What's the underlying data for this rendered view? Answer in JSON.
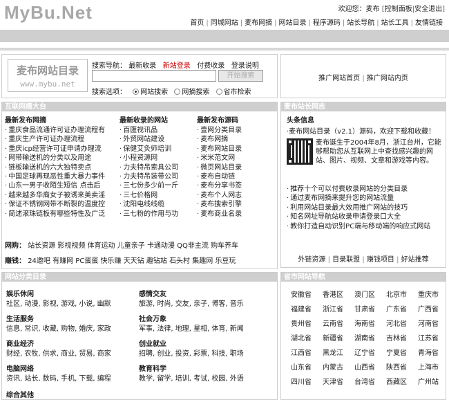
{
  "logo": "MyBu.Net",
  "welcome": {
    "prefix": "欢迎您：",
    "user": "麦布",
    "panel": "控制面板",
    "logout": "安全退出"
  },
  "topnav": [
    "首页",
    "同城网站",
    "麦布网摘",
    "网站目录",
    "程序源码",
    "站长导航",
    "站长工具",
    "友情链接"
  ],
  "search": {
    "site_logo_title": "麦布网站目录",
    "site_logo_url": "www.mybu.net",
    "nav_label": "搜索导航：",
    "nav_links": [
      "最新收录",
      "新站登录",
      "付费收录",
      "登录说明"
    ],
    "button": "开始搜索",
    "options_label": "搜索选项：",
    "options": [
      "网站搜索",
      "网摘搜索",
      "省市检索"
    ]
  },
  "promo": {
    "links": [
      "推广网站首页",
      "推广网站内页"
    ]
  },
  "left": {
    "header": "互联网摘大台",
    "col_heads": [
      "最新发布网摘",
      "最新收录的网站",
      "最新发布源码"
    ],
    "col1": [
      "重庆食品流通许可证办理流程有",
      "重庆生产许可证办理流程",
      "重庆icp经营许可证申请办理流",
      "网带输送机的分类以及用途",
      "链板输送机的六大独特卖点",
      "中国足球再现恶性重大暴力事件",
      "山东一男子收陌生短信 点击后",
      "越来越多华裔女子被诱来美卖淫",
      "保证不锈钢网带不断裂的温度控",
      "简述滚珠链板有哪些特性及广泛"
    ],
    "col2": [
      "百匯视讯品",
      "外贸网站建设",
      "保健艾灸师培训",
      "小程资源网",
      "力夫特吊索具公司",
      "力夫特吊装带公司",
      "三七份多少前一斤",
      "三七价格网",
      "沈阳电线线缆",
      "三七粉的作用与功"
    ],
    "col3": [
      "壹网分类目录",
      "麦布网摘",
      "麦布网站目录",
      "米米范文网",
      "微页网站目录",
      "麦布自动链",
      "麦布分享书签",
      "麦布个人网志",
      "麦布搜索引擎",
      "麦布商业名录"
    ],
    "row_wangou_label": "网购：",
    "row_wangou": [
      "站长资源",
      "影视视频",
      "体育运动",
      "儿童亲子",
      "卡通动漫",
      "QQ非主流",
      "购车养车"
    ],
    "row_zhuanqian_label": "赚钱：",
    "row_zhuanqian": [
      "24邀吧",
      "有赚网",
      "PC蛋蛋",
      "快乐赚",
      "天天钻",
      "趣钻站",
      "石头村",
      "集趣网",
      "乐豆玩"
    ]
  },
  "right": {
    "header": "麦布站长网志",
    "subhead": "头条信息",
    "lead": "·麦布网站目录（v2.1）源码，欢迎下载和收藏！",
    "blurb": "麦布诞生于2004年8月，浙江台州，它能够帮助您从互联网上中查找感兴趣的网站、图片、视频、文章和游戏等内容。",
    "list": [
      "推荐十个可以付费收录网站的分类目录",
      "通过麦布网摘来提升您的网站流量",
      "利用网站目录最大效用推广网站的技巧",
      "知名网址导航站收录申请登录口大全",
      "教你打造自动识别PC端与移动端的响应式网站"
    ],
    "bottom_links": [
      "外链资源",
      "目录联盟",
      "赚钱项目",
      "好站推荐"
    ]
  },
  "cats": {
    "header": "网站分类目录",
    "items": [
      {
        "title": "娱乐休闲",
        "links": "社区, 动漫, 影视, 游戏, 小说, 幽默"
      },
      {
        "title": "感情交友",
        "links": "旅游, 时尚, 交友, 亲子, 博客, 音乐"
      },
      {
        "title": "生活服务",
        "links": "信息, 常识, 收藏, 购物, 婚庆, 家政"
      },
      {
        "title": "社会万象",
        "links": "军事, 法律, 地理, 星相, 体育, 新闻"
      },
      {
        "title": "商业经济",
        "links": "财经, 农牧, 供求, 商业, 贸易, 商家"
      },
      {
        "title": "创业就业",
        "links": "招聘, 创业, 投资, 彩票, 科技, 职场"
      },
      {
        "title": "电脑网络",
        "links": "资讯, 站长, 数码, 手机, 下载, 编程"
      },
      {
        "title": "教育科学",
        "links": "教学, 留学, 培训, 考试, 校园, 外语"
      },
      {
        "title": "综合其他",
        "links": ""
      }
    ]
  },
  "prov": {
    "header": "省市网站导航",
    "items": [
      "安徽省",
      "香港区",
      "澳门区",
      "北京市",
      "重庆市",
      "福建省",
      "浙江省",
      "甘肃省",
      "广东省",
      "广西省",
      "贵州省",
      "云南省",
      "海南省",
      "河北省",
      "河南省",
      "湖北省",
      "新疆省",
      "湖南省",
      "吉林省",
      "江苏省",
      "江西省",
      "黑龙江",
      "辽宁省",
      "宁夏省",
      "青海省",
      "山东省",
      "内蒙古",
      "山西省",
      "陕西省",
      "上海市",
      "四川省",
      "天津省",
      "台湾省",
      "西藏区",
      "广州站"
    ]
  }
}
